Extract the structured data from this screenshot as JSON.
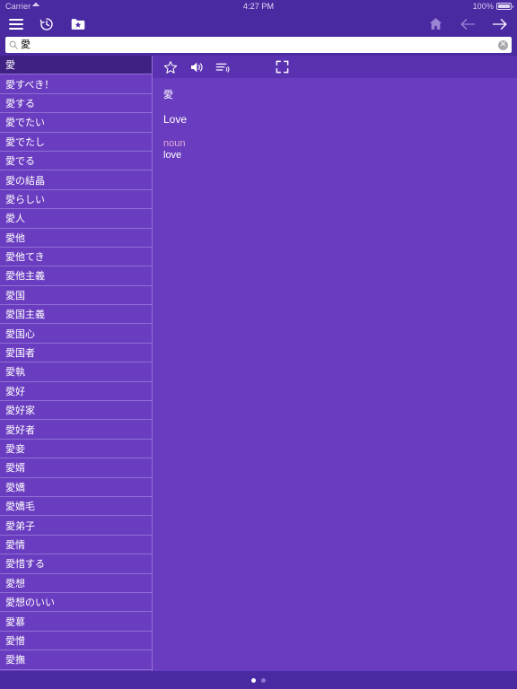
{
  "status_bar": {
    "carrier": "Carrier",
    "wifi_icon": "wifi-icon",
    "time": "4:27 PM",
    "battery_percent": "100%",
    "battery_icon": "battery-icon"
  },
  "toolbar": {
    "menu_icon": "hamburger-menu-icon",
    "history_icon": "history-clock-icon",
    "bookmarks_icon": "folder-star-icon",
    "home_icon": "home-icon",
    "back_icon": "arrow-left-icon",
    "forward_icon": "arrow-right-icon"
  },
  "search": {
    "icon": "search-icon",
    "value": "愛",
    "placeholder": "",
    "clear_label": "✕",
    "clear_icon": "clear-circle-icon"
  },
  "entry_list": {
    "selected_index": 0,
    "items": [
      "愛",
      "愛すべき！",
      "愛する",
      "愛でたい",
      "愛でたし",
      "愛でる",
      "愛の結晶",
      "愛らしい",
      "愛人",
      "愛他",
      "愛他てき",
      "愛他主義",
      "愛国",
      "愛国主義",
      "愛国心",
      "愛国者",
      "愛執",
      "愛好",
      "愛好家",
      "愛好者",
      "愛妾",
      "愛婿",
      "愛嬌",
      "愛嬌毛",
      "愛弟子",
      "愛情",
      "愛惜する",
      "愛想",
      "愛想のいい",
      "愛慕",
      "愛憎",
      "愛撫"
    ]
  },
  "detail": {
    "toolbar": {
      "favorite_icon": "star-outline-icon",
      "pronounce_icon": "speaker-icon",
      "read_aloud_icon": "text-to-speech-icon",
      "fullscreen_icon": "fullscreen-expand-icon"
    },
    "headword": "愛",
    "translation": "Love",
    "part_of_speech": "noun",
    "sense": "love"
  },
  "page_dots": {
    "count": 2,
    "active_index": 0
  },
  "colors": {
    "chrome": "#4a2aa0",
    "pane": "#6a3dc0",
    "selected_row": "#3e2182",
    "divider": "#8f6fd4",
    "pos_text": "#e0a8d8",
    "dim_icon": "#9a84d4"
  }
}
